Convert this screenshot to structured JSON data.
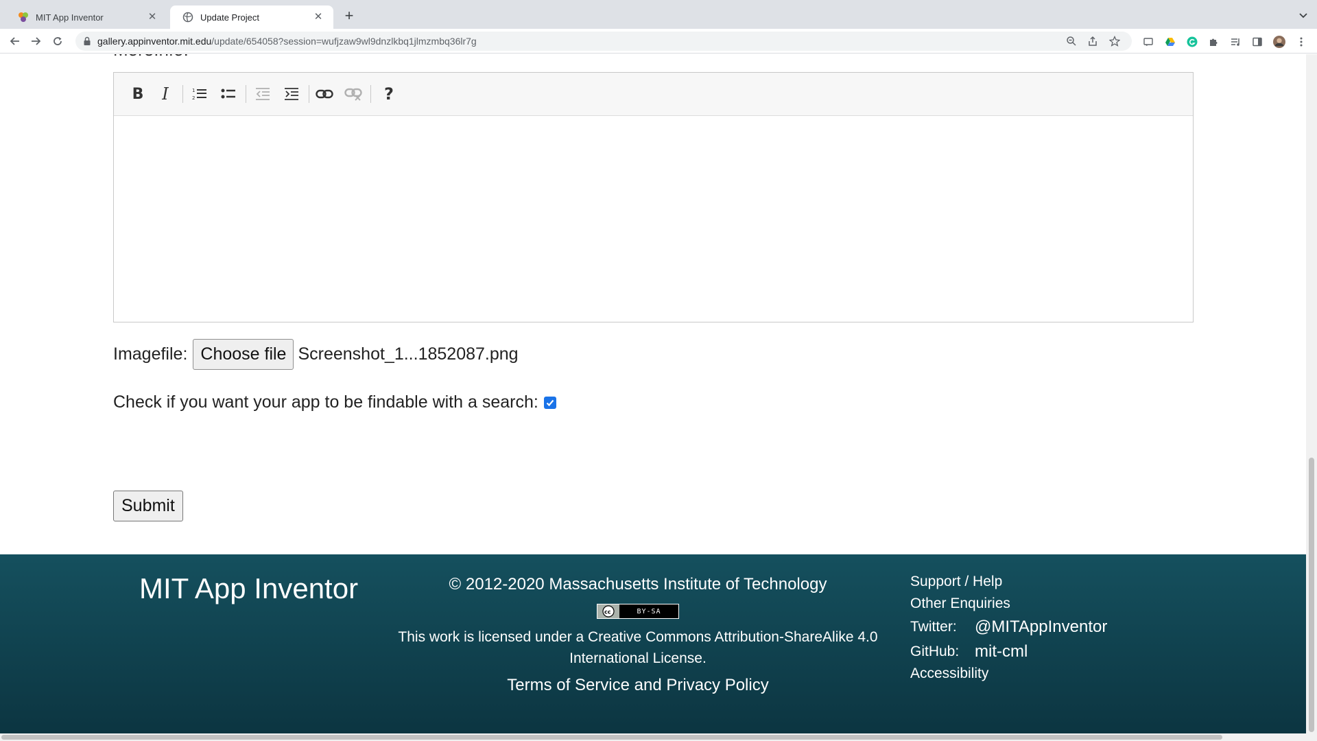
{
  "browser": {
    "tabs": [
      {
        "title": "MIT App Inventor",
        "favicon": "app-inventor-icon"
      },
      {
        "title": "Update Project",
        "favicon": "globe-icon"
      }
    ],
    "url_host": "gallery.appinventor.mit.edu",
    "url_path": "/update/654058?session=wufjzaw9wl9dnzlkbq1jlmzmbq36lr7g"
  },
  "form": {
    "cut_label": "MoreInfo:",
    "editor_tools": [
      "bold-icon",
      "italic-icon",
      "numbered-list-icon",
      "bulleted-list-icon",
      "outdent-icon",
      "indent-icon",
      "link-icon",
      "unlink-icon",
      "help-icon"
    ],
    "imagefile_label": "Imagefile:",
    "choose_file_label": "Choose file",
    "file_name": "Screenshot_1...1852087.png",
    "findable_label": "Check if you want your app to be findable with a search:",
    "findable_checked": true,
    "submit_label": "Submit"
  },
  "footer": {
    "brand": "MIT App Inventor",
    "copyright": "© 2012-2020 Massachusetts Institute of Technology",
    "cc_badge_text": "BY-SA",
    "license": "This work is licensed under a Creative Commons Attribution-ShareAlike 4.0 International License.",
    "terms": "Terms of Service and Privacy Policy",
    "support": "Support / Help",
    "other": "Other Enquiries",
    "twitter_label": "Twitter:",
    "twitter_handle": "@MITAppInventor",
    "github_label": "GitHub:",
    "github_handle": "mit-cml",
    "accessibility": "Accessibility"
  },
  "colors": {
    "footer_bg": "#15505e",
    "checkbox": "#1a73e8"
  }
}
